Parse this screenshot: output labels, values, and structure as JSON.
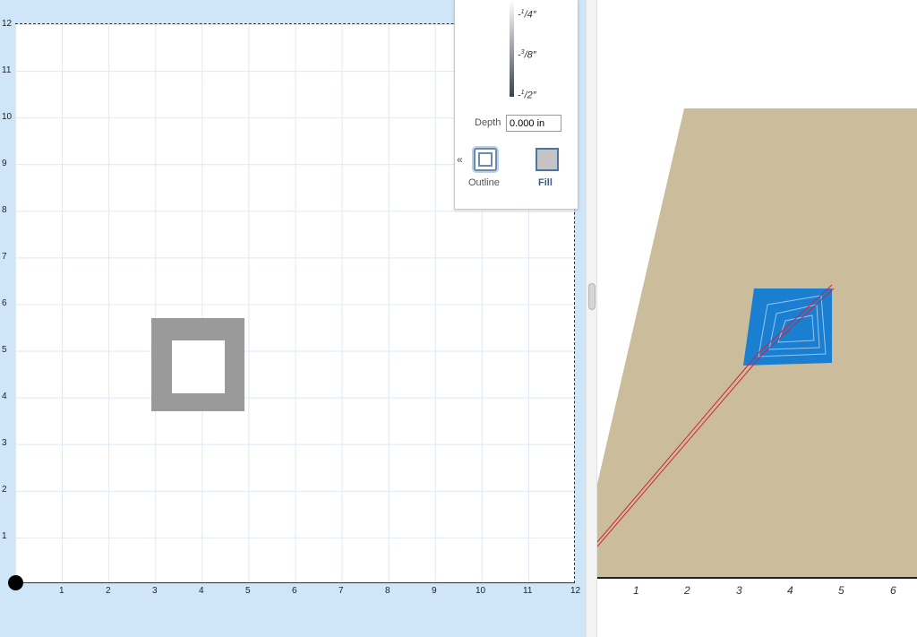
{
  "design_canvas": {
    "x_ticks": [
      "1",
      "2",
      "3",
      "4",
      "5",
      "6",
      "7",
      "8",
      "9",
      "10",
      "11",
      "12"
    ],
    "y_ticks": [
      "12",
      "11",
      "10",
      "9",
      "8",
      "7",
      "6",
      "5",
      "4",
      "3",
      "2",
      "1"
    ]
  },
  "depth_panel": {
    "scale_ticks": [
      {
        "sign": "-",
        "num": "1",
        "den": "4",
        "unit": "″"
      },
      {
        "sign": "-",
        "num": "3",
        "den": "8",
        "unit": "″"
      },
      {
        "sign": "-",
        "num": "1",
        "den": "2",
        "unit": "″"
      }
    ],
    "depth_label": "Depth",
    "depth_value": "0.000 in",
    "collapse_icon": "«",
    "outline_label": "Outline",
    "fill_label": "Fill",
    "selected_mode": "Fill"
  },
  "preview": {
    "x_ticks": [
      "1",
      "2",
      "3",
      "4",
      "5",
      "6"
    ],
    "material_color": "#cbbd9b",
    "cut_color": "#1a7fd1",
    "toolpath_color": "#d0223a"
  },
  "colors": {
    "canvas_background": "#cfe5f8",
    "shape_fill": "#9a9a9a"
  }
}
